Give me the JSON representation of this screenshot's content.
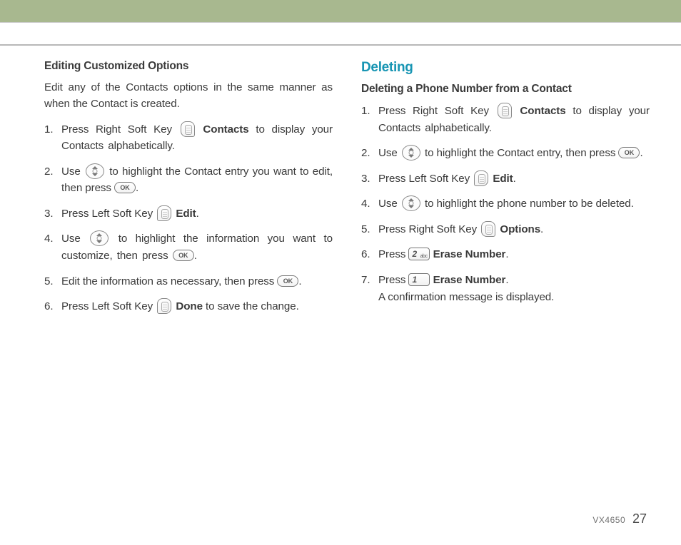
{
  "left": {
    "subhead": "Editing Customized Options",
    "intro": "Edit any of the Contacts options in the same manner as when the Contact is created.",
    "steps": {
      "s1a": "Press Right Soft Key ",
      "s1b": "Contacts",
      "s1c": " to display your Contacts alphabetically.",
      "s2a": "Use ",
      "s2b": " to highlight the Contact entry you want to edit, then press ",
      "s3a": "Press Left Soft Key ",
      "s3b": "Edit",
      "s4a": "Use ",
      "s4b": " to highlight the information you want to customize, then press ",
      "s5a": "Edit the information as necessary, then press ",
      "s6a": "Press Left Soft Key ",
      "s6b": "Done",
      "s6c": " to save the change."
    }
  },
  "right": {
    "title": "Deleting",
    "subhead": "Deleting a Phone Number from a Contact",
    "steps": {
      "s1a": "Press Right Soft Key ",
      "s1b": "Contacts",
      "s1c": " to display your Contacts alphabetically.",
      "s2a": "Use ",
      "s2b": " to highlight the Contact entry, then press ",
      "s3a": "Press Left Soft Key ",
      "s3b": "Edit",
      "s4a": "Use ",
      "s4b": " to highlight the phone number to be deleted.",
      "s5a": "Press Right Soft Key ",
      "s5b": "Options",
      "s6a": "Press ",
      "s6b": "Erase Number",
      "s7a": "Press ",
      "s7b": "Erase Number",
      "s7c": "A confirmation message is displayed."
    }
  },
  "keys": {
    "ok": "OK",
    "key2d": "2",
    "key2s": "abc",
    "key1d": "1",
    "key1s": ""
  },
  "footer": {
    "model": "VX4650",
    "page": "27"
  }
}
